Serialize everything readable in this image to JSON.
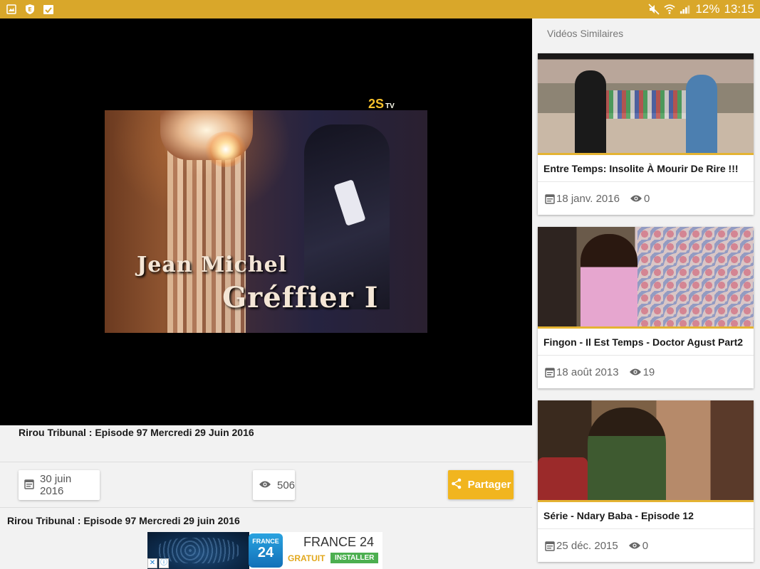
{
  "status_bar": {
    "battery": "12%",
    "time": "13:15",
    "left_icons": [
      "gallery-icon",
      "shield-icon",
      "clipboard-check-icon"
    ],
    "right_icons": [
      "mute-icon",
      "wifi-icon",
      "signal-icon"
    ],
    "background_color": "#d9a72a"
  },
  "player": {
    "caption_line1": "Jean Michel",
    "caption_line2": "Gréffier I",
    "channel_logo": "2S",
    "channel_logo_suffix": "TV"
  },
  "video": {
    "title": "Rirou Tribunal : Episode 97 Mercredi 29 Juin 2016",
    "date": "30 juin 2016",
    "views": "506",
    "share_label": "Partager",
    "description_title": "Rirou Tribunal : Episode 97 Mercredi 29 juin 2016",
    "accent_color": "#f1b51f"
  },
  "ad": {
    "logo_top": "FRANCE",
    "logo_bottom": "24",
    "name": "FRANCE 24",
    "free_label": "GRATUIT",
    "install_label": "INSTALLER"
  },
  "sidebar": {
    "heading": "Vidéos Similaires",
    "items": [
      {
        "title": "Entre Temps: Insolite À Mourir De Rire !!!",
        "date": "18 janv. 2016",
        "views": "0"
      },
      {
        "title": "Fingon - Il Est Temps - Doctor Agust Part2",
        "date": "18 août 2013",
        "views": "19"
      },
      {
        "title": "Série - Ndary Baba - Episode 12",
        "date": "25 déc. 2015",
        "views": "0"
      }
    ]
  }
}
